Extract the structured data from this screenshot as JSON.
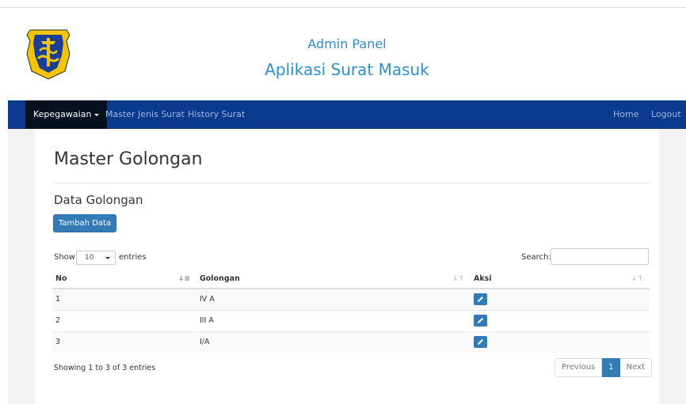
{
  "header": {
    "admin_title": "Admin Panel",
    "app_title": "Aplikasi Surat Masuk",
    "logo_icon": "surabaya-crest-icon"
  },
  "navbar": {
    "left": [
      {
        "label": "Kepegawaian",
        "active": true,
        "dropdown": true
      },
      {
        "label": "Master Jenis Surat"
      },
      {
        "label": "History Surat"
      }
    ],
    "right": [
      {
        "label": "Home"
      },
      {
        "label": "Logout"
      }
    ]
  },
  "page": {
    "title": "Master Golongan",
    "section_title": "Data Golongan",
    "add_button": "Tambah Data"
  },
  "datatable": {
    "show_label": "Show",
    "page_length": "10",
    "entries_label": "entries",
    "search_label": "Search:",
    "search_value": "",
    "columns": [
      "No",
      "Golongan",
      "Aksi"
    ],
    "rows": [
      {
        "no": "1",
        "golongan": "IV A"
      },
      {
        "no": "2",
        "golongan": "III A"
      },
      {
        "no": "3",
        "golongan": "I/A"
      }
    ],
    "info": "Showing 1 to 3 of 3 entries",
    "pagination": {
      "previous": "Previous",
      "current": "1",
      "next": "Next"
    }
  },
  "colors": {
    "navbar": "#0b3a8c",
    "accent": "#2a8fd6",
    "primary": "#337ab7"
  }
}
